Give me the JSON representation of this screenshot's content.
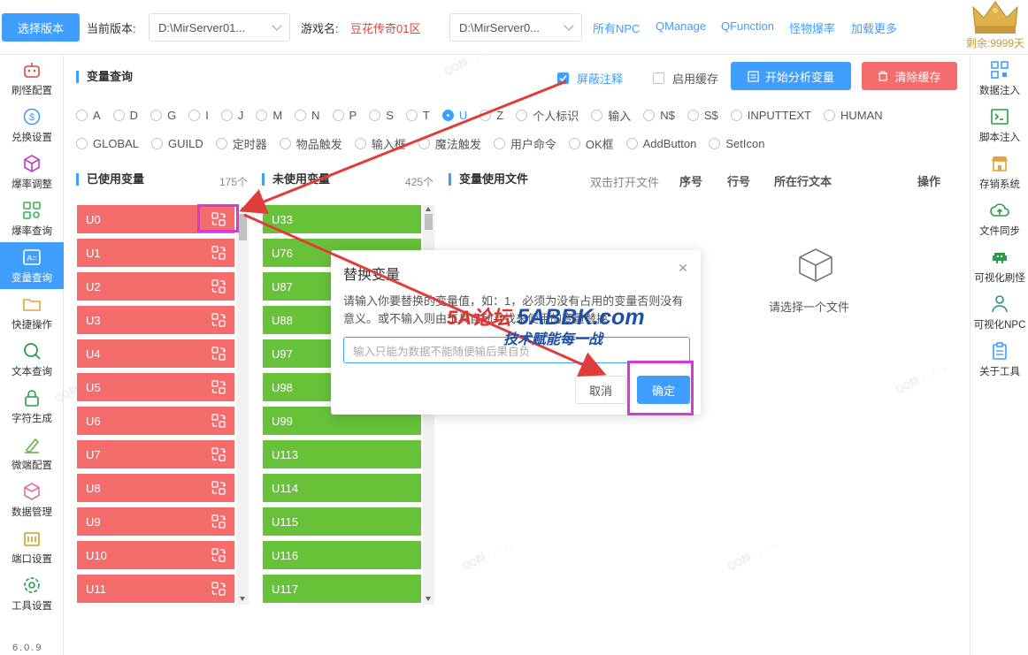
{
  "topbar": {
    "select_version_label": "选择版本",
    "current_version_label": "当前版本:",
    "current_version_value": "D:\\MirServer01...",
    "game_name_label": "游戏名:",
    "game_name_value": "豆花传奇01区",
    "path_select_value": "D:\\MirServer0...",
    "links": [
      "所有NPC",
      "QManage",
      "QFunction",
      "怪物爆率",
      "加载更多"
    ],
    "remaining": "剩余:9999天"
  },
  "left_sidebar": [
    {
      "label": "刷怪配置",
      "icon": "robot-icon"
    },
    {
      "label": "兑换设置",
      "icon": "coin-icon"
    },
    {
      "label": "爆率调整",
      "icon": "box-icon"
    },
    {
      "label": "爆率查询",
      "icon": "grid-search-icon"
    },
    {
      "label": "变量查询",
      "icon": "variable-icon"
    },
    {
      "label": "快捷操作",
      "icon": "folder-icon"
    },
    {
      "label": "文本查询",
      "icon": "search-icon"
    },
    {
      "label": "字符生成",
      "icon": "lock-icon"
    },
    {
      "label": "微端配置",
      "icon": "pen-icon"
    },
    {
      "label": "数据管理",
      "icon": "cube-icon"
    },
    {
      "label": "端口设置",
      "icon": "port-icon"
    },
    {
      "label": "工具设置",
      "icon": "gear-icon"
    }
  ],
  "version": "6.0.9",
  "right_sidebar": [
    {
      "label": "数据注入",
      "icon": "qr-icon"
    },
    {
      "label": "脚本注入",
      "icon": "terminal-icon"
    },
    {
      "label": "存销系统",
      "icon": "store-icon"
    },
    {
      "label": "文件同步",
      "icon": "cloud-sync-icon"
    },
    {
      "label": "可视化刷怪",
      "icon": "invader-icon"
    },
    {
      "label": "可视化NPC",
      "icon": "npc-icon"
    },
    {
      "label": "关于工具",
      "icon": "clipboard-icon"
    }
  ],
  "main": {
    "title": "变量查询",
    "hide_comments": "屏蔽注释",
    "enable_cache": "启用缓存",
    "analyze_button": "开始分析变量",
    "clear_cache_button": "清除缓存",
    "radios_row1": [
      "A",
      "D",
      "G",
      "I",
      "J",
      "M",
      "N",
      "P",
      "S",
      "T",
      "U",
      "Z",
      "个人标识",
      "输入",
      "N$",
      "S$",
      "INPUTTEXT",
      "HUMAN"
    ],
    "radios_row2": [
      "GLOBAL",
      "GUILD",
      "定时器",
      "物品触发",
      "输入框",
      "魔法触发",
      "用户命令",
      "OK框",
      "AddButton",
      "SetIcon"
    ],
    "selected_radio": "U",
    "used_title": "已使用变量",
    "used_count": "175个",
    "unused_title": "未使用变量",
    "unused_count": "425个",
    "files_title": "变量使用文件",
    "open_file_hint": "双击打开文件",
    "file_columns": [
      "序号",
      "行号",
      "所在行文本",
      "操作"
    ],
    "empty_text": "请选择一个文件",
    "used_vars": [
      "U0",
      "U1",
      "U2",
      "U3",
      "U4",
      "U5",
      "U6",
      "U7",
      "U8",
      "U9",
      "U10",
      "U11"
    ],
    "unused_vars": [
      "U33",
      "U76",
      "U87",
      "U88",
      "U97",
      "U98",
      "U99",
      "U113",
      "U114",
      "U115",
      "U116",
      "U117"
    ]
  },
  "dialog": {
    "title": "替换变量",
    "message": "请输入你要替换的变量值，如：1，必须为没有占用的变量否则没有意义。或不输入则由工具自动寻找未使用的变量替换",
    "placeholder": "输入只能为数据不能随便输后果自负",
    "cancel": "取消",
    "confirm": "确定"
  },
  "watermark": {
    "logo_a": "5A论坛",
    "logo_b": "5ABBK.com",
    "slogan": "技术赋能每一战"
  },
  "colors": {
    "primary": "#409eff",
    "used_bg": "#f56c6c",
    "unused_bg": "#67c23a",
    "highlight": "#d63ad6",
    "arrow": "#e03c3c"
  }
}
